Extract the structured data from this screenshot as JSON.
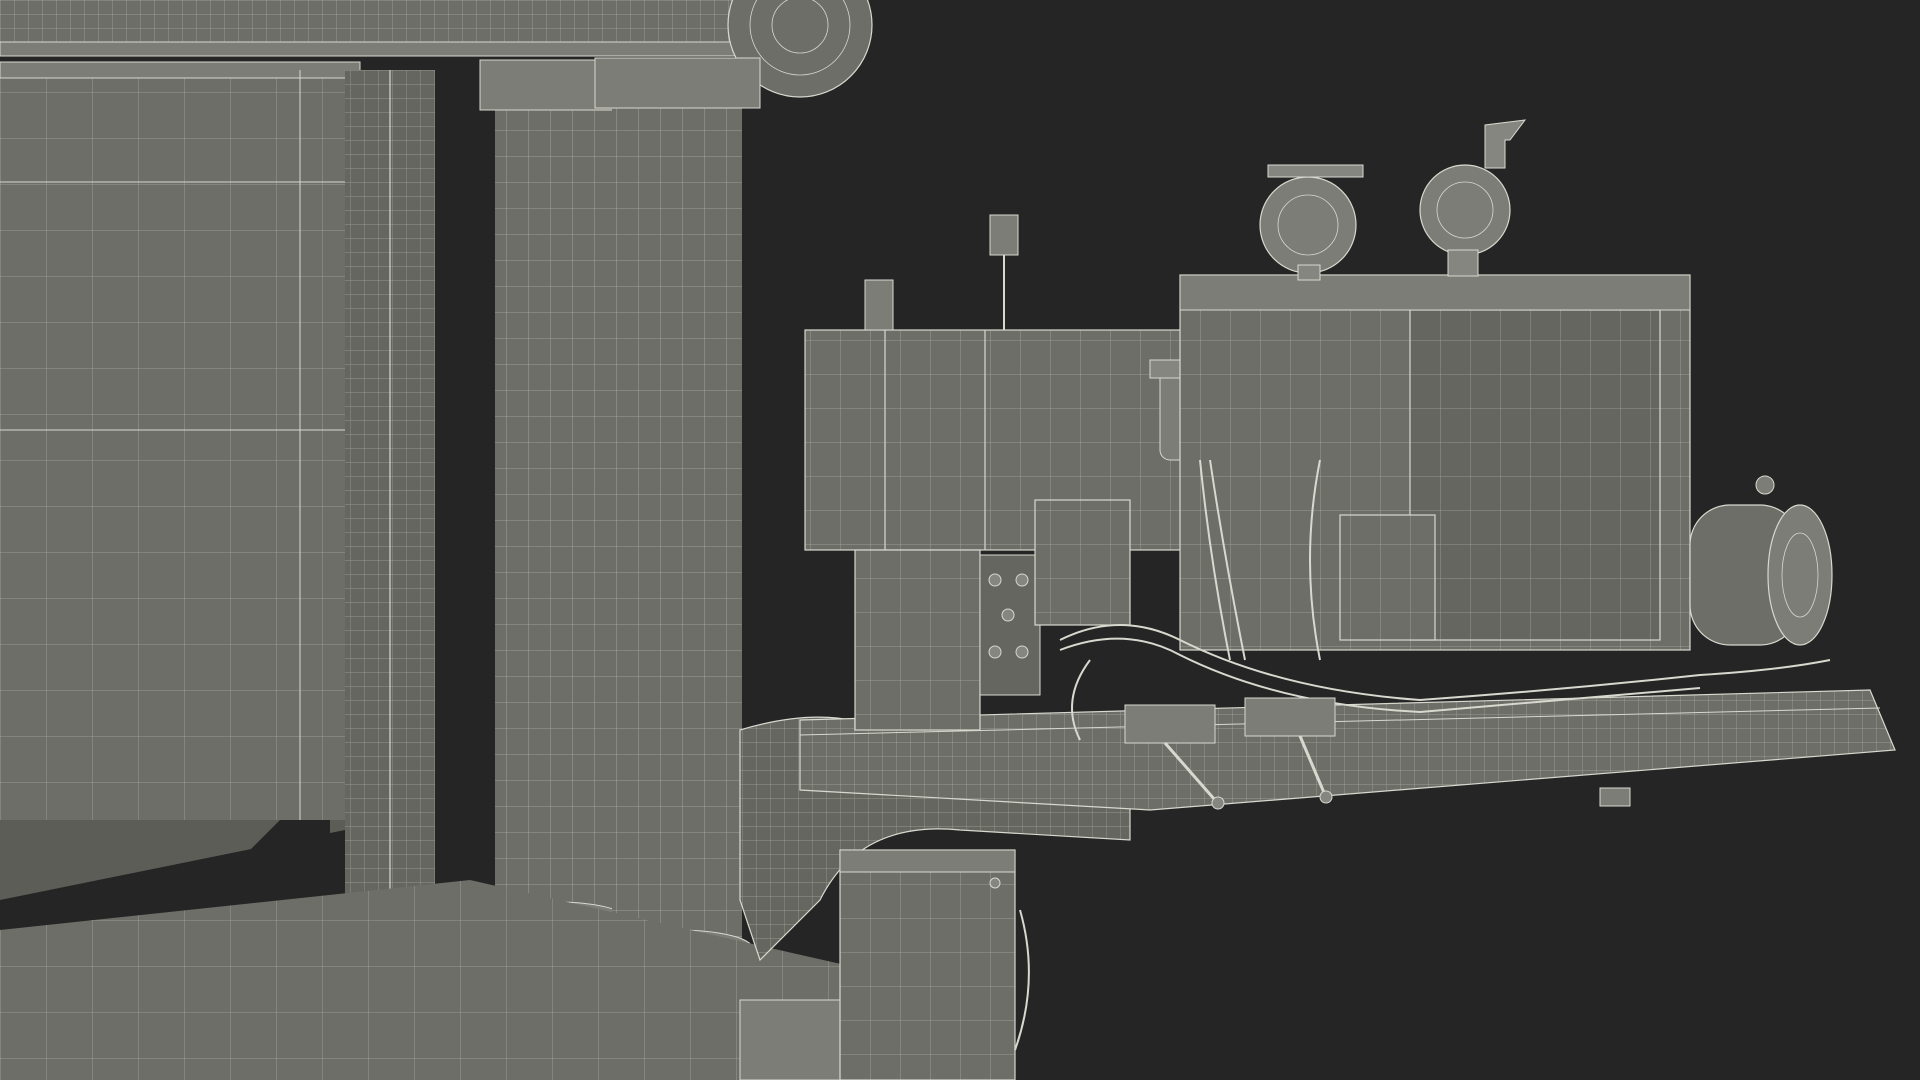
{
  "scene": {
    "background_color": "#252525",
    "surface_color": "#6d6e68",
    "surface_dark_color": "#55564f",
    "surface_light_color": "#7c7d76",
    "wire_color": "#d8d8cf",
    "description_kind": "wireframe-3d-render"
  }
}
